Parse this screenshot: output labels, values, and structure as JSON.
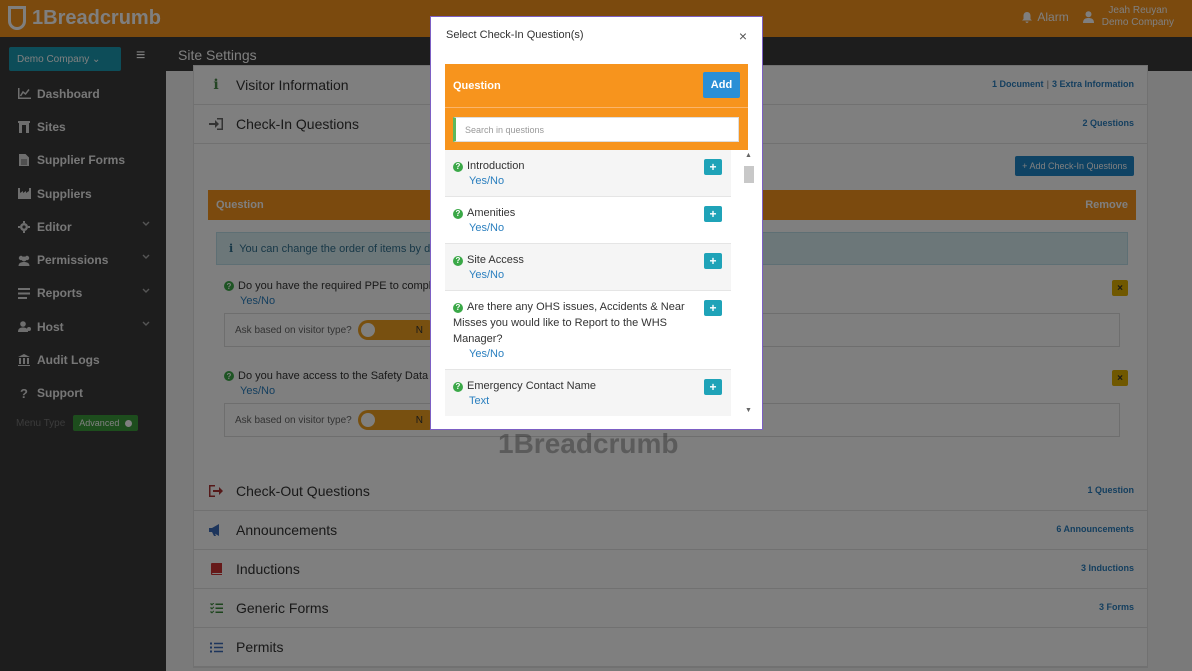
{
  "app": {
    "brand": "1Breadcrumb",
    "brand_prefix": "1Bread",
    "brand_suffix": "crumb"
  },
  "topbar": {
    "alarm_label": "Alarm",
    "user_name": "Jeah Reuyan",
    "user_company": "Demo Company"
  },
  "sidebar": {
    "company_selector": "Demo Company ⌄",
    "items": [
      {
        "label": "Dashboard",
        "icon": "chart-icon"
      },
      {
        "label": "Sites",
        "icon": "building-icon"
      },
      {
        "label": "Supplier Forms",
        "icon": "document-icon"
      },
      {
        "label": "Suppliers",
        "icon": "factory-icon"
      },
      {
        "label": "Editor",
        "icon": "gear-icon"
      },
      {
        "label": "Permissions",
        "icon": "users-icon"
      },
      {
        "label": "Reports",
        "icon": "list-icon"
      },
      {
        "label": "Host",
        "icon": "user-icon"
      },
      {
        "label": "Audit Logs",
        "icon": "bank-icon"
      },
      {
        "label": "Support",
        "icon": "question-icon"
      }
    ],
    "menu_type_label": "Menu Type",
    "menu_type_value": "Advanced"
  },
  "page": {
    "title": "Site Settings"
  },
  "sections": {
    "visitor_info": {
      "label": "Visitor Information",
      "count_a": "1 Document",
      "count_b": "3 Extra Information"
    },
    "checkin": {
      "label": "Check-In Questions",
      "count": "2 Questions",
      "add_button": "Add Check-In Questions"
    },
    "checkout": {
      "label": "Check-Out Questions",
      "count": "1 Question"
    },
    "announcements": {
      "label": "Announcements",
      "count": "6 Announcements"
    },
    "inductions": {
      "label": "Inductions",
      "count": "3 Inductions"
    },
    "generic_forms": {
      "label": "Generic Forms",
      "count": "3 Forms"
    },
    "permits": {
      "label": "Permits"
    }
  },
  "checkin_table": {
    "col_question": "Question",
    "col_remove": "Remove",
    "info": "You can change the order of items by dra",
    "rows": [
      {
        "question": "Do you have the required PPE to complet",
        "answer": "Yes/No",
        "ask_label": "Ask based on visitor type?",
        "toggle": "N"
      },
      {
        "question": "Do you have access to the Safety Data Sh",
        "answer": "Yes/No",
        "ask_label": "Ask based on visitor type?",
        "toggle": "N"
      }
    ],
    "remove_symbol": "×"
  },
  "watermark": "1Breadcrumb",
  "modal": {
    "title": "Select Check-In Question(s)",
    "close": "×",
    "header": "Question",
    "add_button": "Add",
    "search_placeholder": "Search in questions",
    "questions": [
      {
        "text": "Introduction",
        "type": "Yes/No"
      },
      {
        "text": "Amenities",
        "type": "Yes/No"
      },
      {
        "text": "Site Access",
        "type": "Yes/No"
      },
      {
        "text": "Are there any OHS issues, Accidents & Near Misses you would like to Report to the WHS Manager?",
        "type": "Yes/No"
      },
      {
        "text": "Emergency Contact Name",
        "type": "Text"
      }
    ],
    "plus_symbol": "+"
  },
  "colors": {
    "accent": "#f7941d",
    "sidebar_bg": "#3b3b3b",
    "link": "#2a7fbf",
    "teal": "#1fa3b8"
  }
}
